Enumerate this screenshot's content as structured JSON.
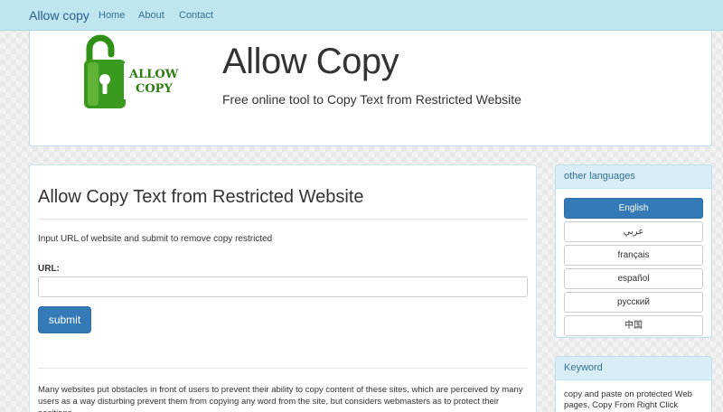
{
  "navbar": {
    "brand": "Allow copy",
    "links": [
      "Home",
      "About",
      "Contact"
    ]
  },
  "header": {
    "logo_text_line1": "ALLOW",
    "logo_text_line2": "COPY",
    "title": "Allow Copy",
    "subtitle": "Free online tool to Copy Text from Restricted Website"
  },
  "main": {
    "title": "Allow Copy Text from Restricted Website",
    "hint": "Input URL of website and submit to remove copy restricted",
    "url_label": "URL:",
    "url_value": "",
    "submit_label": "submit",
    "description": "Many websites put obstacles in front of users to prevent their ability to copy content of these sites, which are perceived by many users as a way disturbing prevent them from copying any word from the site, but considers webmasters as to protect their positions"
  },
  "languages": {
    "heading": "other languages",
    "items": [
      "English",
      "عربي",
      "français",
      "español",
      "русский",
      "中国"
    ],
    "active": "English"
  },
  "keyword": {
    "heading": "Keyword",
    "text": "copy and paste on protected Web pages, Copy From Right Click"
  },
  "colors": {
    "navbar_bg": "#bfe6ee",
    "primary": "#337ab7",
    "panel_heading_bg": "#d9edf7",
    "logo_green": "#3a9a1e",
    "logo_text": "#2e7d12"
  }
}
